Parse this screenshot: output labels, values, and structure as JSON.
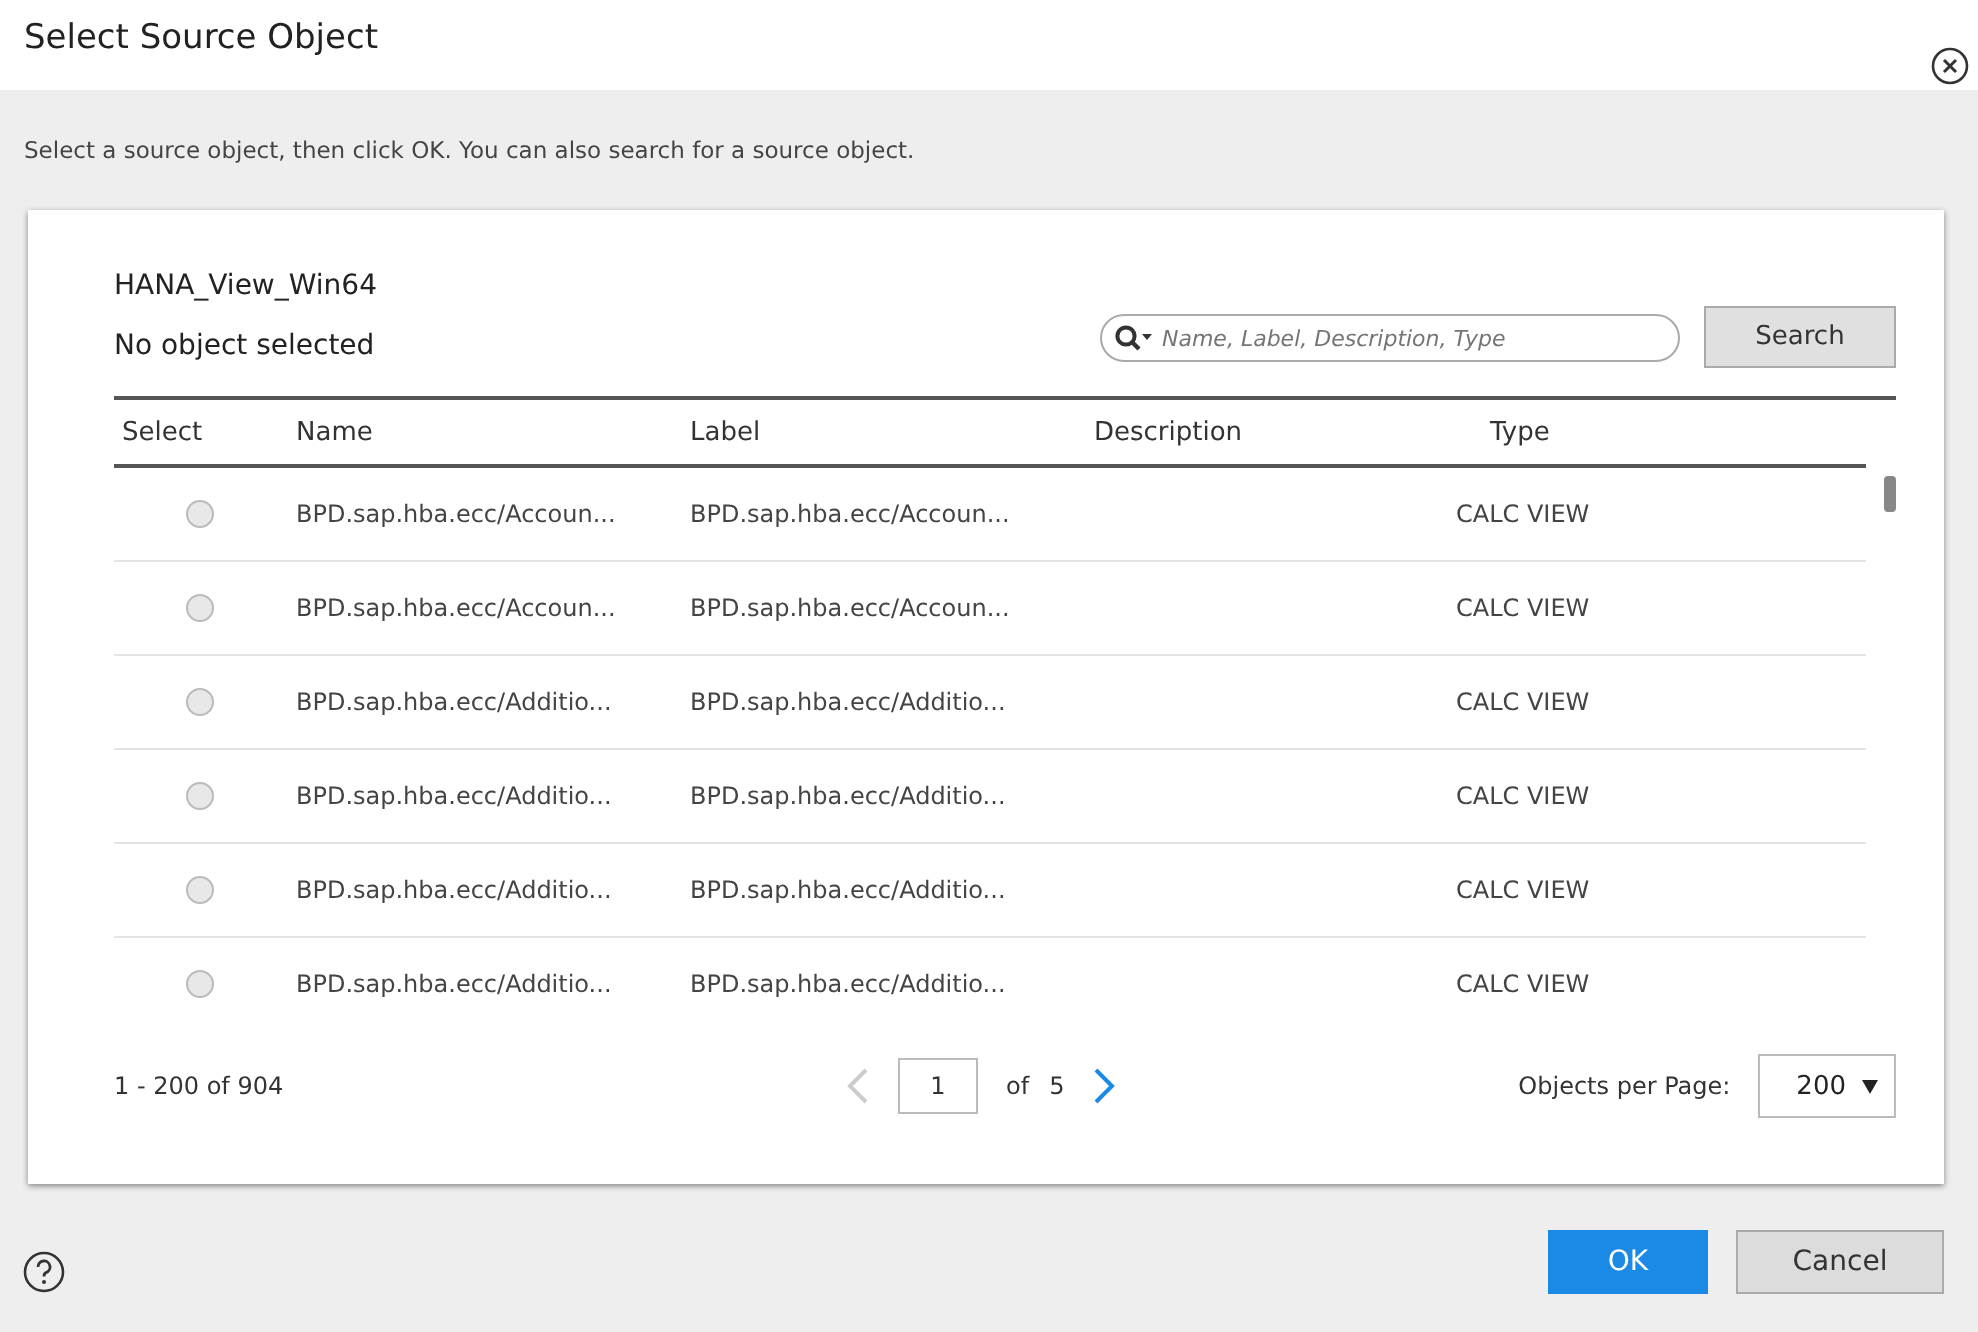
{
  "window": {
    "title": "Select Source Object"
  },
  "instructions": "Select a source object, then click OK. You can also search for a source object.",
  "connection": "HANA_View_Win64",
  "selection_status": "No object selected",
  "search": {
    "placeholder": "Name, Label, Description, Type",
    "button": "Search"
  },
  "table": {
    "columns": [
      "Select",
      "Name",
      "Label",
      "Description",
      "Type"
    ],
    "rows": [
      {
        "selected": false,
        "name": "BPD.sap.hba.ecc/Accoun...",
        "label": "BPD.sap.hba.ecc/Accoun...",
        "type": "CALC VIEW"
      },
      {
        "selected": false,
        "name": "BPD.sap.hba.ecc/Accoun...",
        "label": "BPD.sap.hba.ecc/Accoun...",
        "type": "CALC VIEW"
      },
      {
        "selected": false,
        "name": "BPD.sap.hba.ecc/Additio...",
        "label": "BPD.sap.hba.ecc/Additio...",
        "type": "CALC VIEW"
      },
      {
        "selected": false,
        "name": "BPD.sap.hba.ecc/Additio...",
        "label": "BPD.sap.hba.ecc/Additio...",
        "type": "CALC VIEW"
      },
      {
        "selected": false,
        "name": "BPD.sap.hba.ecc/Additio...",
        "label": "BPD.sap.hba.ecc/Additio...",
        "type": "CALC VIEW"
      },
      {
        "selected": false,
        "name": "BPD.sap.hba.ecc/Additio...",
        "label": "BPD.sap.hba.ecc/Additio...",
        "type": "CALC VIEW"
      }
    ]
  },
  "pagination": {
    "range": "1 - 200 of 904",
    "previous_disabled": true,
    "page": "1",
    "of_label": "of",
    "total_pages": "5",
    "next_disabled": false,
    "per_page_label": "Objects per Page:",
    "per_page": "200"
  },
  "buttons": {
    "ok": "OK",
    "cancel": "Cancel"
  }
}
